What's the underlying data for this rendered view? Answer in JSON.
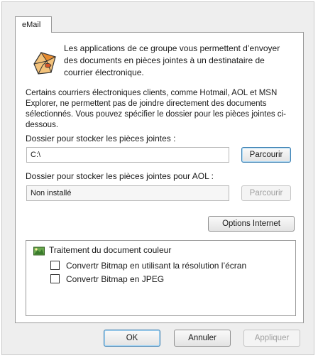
{
  "tab": {
    "label": "eMail"
  },
  "intro_text": "Les applications de ce groupe vous permettent d’envoyer des documents en pièces jointes à un destinataire de courrier électronique.",
  "info_text": "Certains courriers électroniques clients, comme Hotmail, AOL et MSN Explorer, ne permettent pas de joindre directement des documents sélectionnés. Vous pouvez spécifier le dossier pour les pièces jointes ci-dessous.",
  "attachment_folder": {
    "label": "Dossier pour stocker les pièces jointes :",
    "value": "C:\\",
    "browse_label": "Parcourir"
  },
  "aol_folder": {
    "label": "Dossier pour stocker les pièces jointes pour AOL :",
    "value": "Non installé",
    "browse_label": "Parcourir"
  },
  "internet_options_label": "Options Internet",
  "color_group": {
    "title": "Traitement du document couleur",
    "options": [
      {
        "label": "Convertr Bitmap en utilisant la résolution l’écran",
        "checked": false
      },
      {
        "label": "Convertr Bitmap en JPEG",
        "checked": false
      }
    ]
  },
  "buttons": {
    "ok": "OK",
    "cancel": "Annuler",
    "apply": "Appliquer"
  },
  "icons": {
    "logo": "email-app-icon",
    "group": "color-document-icon"
  }
}
